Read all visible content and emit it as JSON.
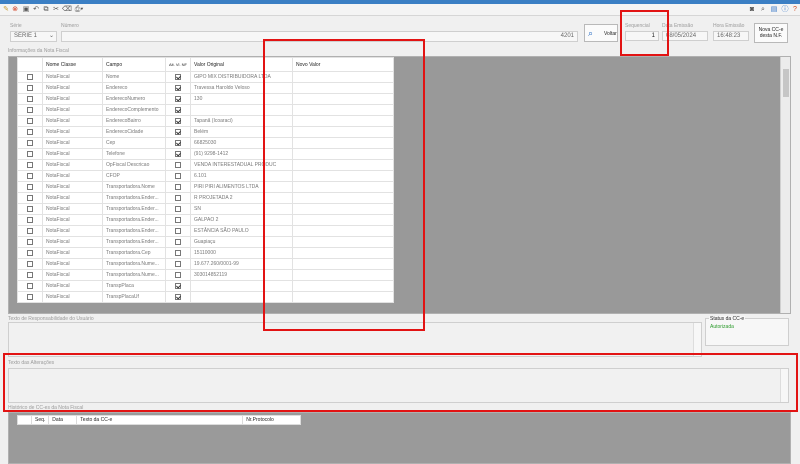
{
  "toolbar": {
    "left_icons": [
      "pencil-icon",
      "cancel-icon",
      "save-icon",
      "undo-icon",
      "copy-icon",
      "cut-icon",
      "delete-icon",
      "print-icon"
    ],
    "right_icons": [
      "camera-icon",
      "search-icon",
      "chat-icon",
      "info-icon",
      "help-icon"
    ]
  },
  "header": {
    "serie_label": "Série",
    "serie_value": "SÉRIE 1",
    "numero_label": "Número",
    "numero_value": "4201",
    "volta_label": "Voltar",
    "sequencial_label": "Sequencial",
    "sequencial_value": "1",
    "data_emissao_label": "Data Emissão",
    "data_emissao_value": "08/05/2024",
    "hora_emissao_label": "Hora Emissão",
    "hora_emissao_value": "16:48:23",
    "nova_cce_label_line1": "Nova CC-e",
    "nova_cce_label_line2": "desta N.F."
  },
  "grid": {
    "section_label": "Informações da Nota Fiscal",
    "columns": [
      "Nome Classe",
      "Campo",
      "Alt. Vl. NF",
      "Valor Original",
      "Novo Valor"
    ],
    "rows": [
      {
        "classe": "NotaFiscal",
        "campo": "Nome",
        "alt": true,
        "original": "GIPO MIX DISTRIBUIDORA LTDA"
      },
      {
        "classe": "NotaFiscal",
        "campo": "Endereco",
        "alt": true,
        "original": "Travessa Haroldo Veloso"
      },
      {
        "classe": "NotaFiscal",
        "campo": "EnderecoNumero",
        "alt": true,
        "original": "130"
      },
      {
        "classe": "NotaFiscal",
        "campo": "EnderecoComplemento",
        "alt": true,
        "original": ""
      },
      {
        "classe": "NotaFiscal",
        "campo": "EnderecoBairro",
        "alt": true,
        "original": "Tapanã (Icoaraci)"
      },
      {
        "classe": "NotaFiscal",
        "campo": "EnderecoCidade",
        "alt": true,
        "original": "Belém"
      },
      {
        "classe": "NotaFiscal",
        "campo": "Cep",
        "alt": true,
        "original": "66825030"
      },
      {
        "classe": "NotaFiscal",
        "campo": "Telefone",
        "alt": true,
        "original": "(91) 9298-1412"
      },
      {
        "classe": "NotaFiscal",
        "campo": "OpFiscal Descricao",
        "alt": false,
        "original": "VENDA INTERESTADUAL PRODUC"
      },
      {
        "classe": "NotaFiscal",
        "campo": "CFOP",
        "alt": false,
        "original": "6.101"
      },
      {
        "classe": "NotaFiscal",
        "campo": "Transportadora.Nome",
        "alt": false,
        "original": "PIRI PIRI ALIMENTOS LTDA"
      },
      {
        "classe": "NotaFiscal",
        "campo": "Transportadora.Ender...",
        "alt": false,
        "original": "R PROJETADA 2"
      },
      {
        "classe": "NotaFiscal",
        "campo": "Transportadora.Ender...",
        "alt": false,
        "original": "SN"
      },
      {
        "classe": "NotaFiscal",
        "campo": "Transportadora.Ender...",
        "alt": false,
        "original": "GALPAO 2"
      },
      {
        "classe": "NotaFiscal",
        "campo": "Transportadora.Ender...",
        "alt": false,
        "original": "ESTÂNCIA SÃO PAULO"
      },
      {
        "classe": "NotaFiscal",
        "campo": "Transportadora.Ender...",
        "alt": false,
        "original": "Guapiaçu"
      },
      {
        "classe": "NotaFiscal",
        "campo": "Transportadora.Cep",
        "alt": false,
        "original": "15110000"
      },
      {
        "classe": "NotaFiscal",
        "campo": "Transportadora.Nume...",
        "alt": false,
        "original": "19.677.260/0001-99"
      },
      {
        "classe": "NotaFiscal",
        "campo": "Transportadora.Nume...",
        "alt": false,
        "original": "303014852119"
      },
      {
        "classe": "NotaFiscal",
        "campo": "TranspPlaca",
        "alt": true,
        "original": ""
      },
      {
        "classe": "NotaFiscal",
        "campo": "TranspPlacaUf",
        "alt": true,
        "original": ""
      }
    ]
  },
  "responsabilidade": {
    "label": "Texto de Responsabilidade do Usuário"
  },
  "status": {
    "label": "Status da CC-e",
    "value": "Autorizada",
    "color": "#2a9a2a"
  },
  "alteracoes": {
    "label": "Texto das Alterações"
  },
  "historico": {
    "label": "Histórico de CC-es da Nota Fiscal",
    "columns": [
      "Seq.",
      "Data",
      "Texto da CC-e",
      "Nr.Protocolo"
    ]
  },
  "annotation_color": "#e21313"
}
